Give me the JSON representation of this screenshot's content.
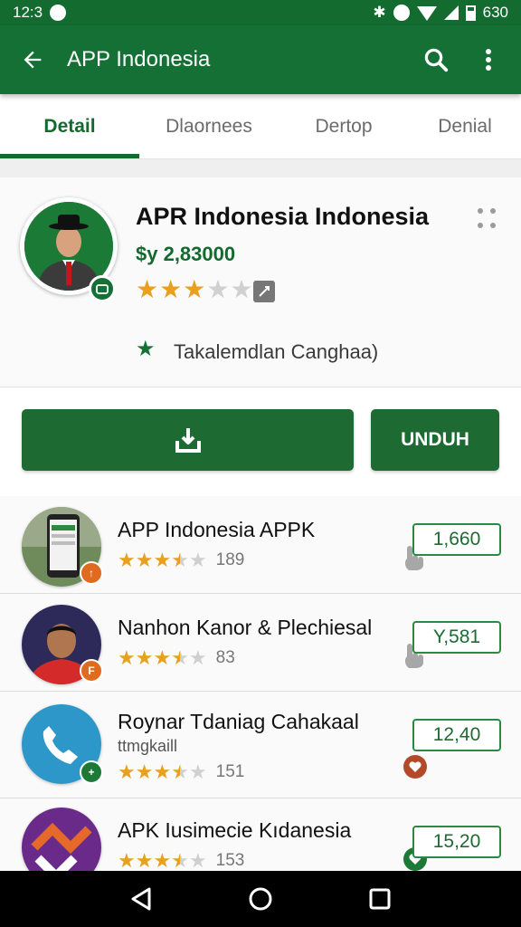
{
  "status": {
    "time": "12:3",
    "battery": "630"
  },
  "appbar": {
    "title": "APP Indonesia"
  },
  "tabs": [
    {
      "label": "Detail"
    },
    {
      "label": "Dlaornees"
    },
    {
      "label": "Dertop"
    },
    {
      "label": "Denial"
    }
  ],
  "detail": {
    "title": "APR Indonesia Indonesia",
    "price": "$y 2,83000",
    "rating": 3,
    "rating_max": 5,
    "developer": "Takalemdlan Canghaa)"
  },
  "actions": {
    "secondary_label": "UNDUH"
  },
  "list": [
    {
      "title": "APP Indonesia APPK",
      "subtitle": "",
      "rating": 3.5,
      "count": "189",
      "price": "1,660"
    },
    {
      "title": "Nanhon Kanor & Plechiesal",
      "subtitle": "",
      "rating": 3.5,
      "count": "83",
      "price": "Y,581"
    },
    {
      "title": "Roynar Tdaniag Cahakaal",
      "subtitle": "ttmgkaill",
      "rating": 3.5,
      "count": "151",
      "price": "12,40"
    },
    {
      "title": "APK Iusimecie Kıdanesia",
      "subtitle": "",
      "rating": 3.5,
      "count": "153",
      "price": "15,20"
    }
  ],
  "colors": {
    "primary": "#157035",
    "accent_star": "#e9a01e",
    "badge_orange": "#e06a1e"
  }
}
